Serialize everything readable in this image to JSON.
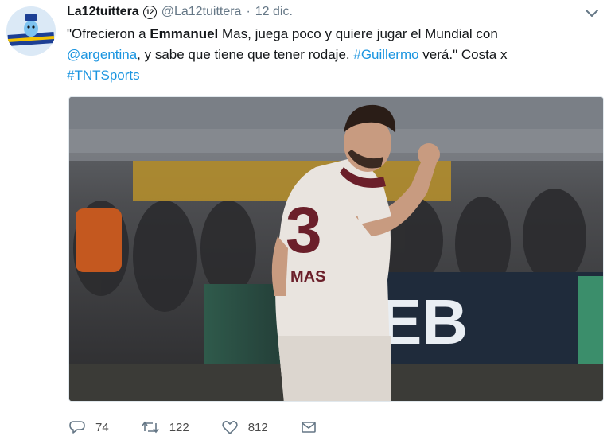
{
  "tweet": {
    "display_name": "La12tuittera",
    "badge_text": "12",
    "handle": "@La12tuittera",
    "separator": "·",
    "date": "12 dic.",
    "text": {
      "part1": "\"Ofrecieron a ",
      "bold1": "Emmanuel",
      "part2": " Mas, juega poco y quiere jugar el Mundial con",
      "mention": "@argentina",
      "part3": ", y sabe que tiene que tener rodaje. ",
      "hashtag1": "#Guillermo",
      "part4": " verá.\" Costa x",
      "hashtag2": "#TNTSports"
    },
    "media": {
      "jersey_number": "3",
      "jersey_name": "MAS",
      "board_text": "EB"
    },
    "actions": {
      "replies": "74",
      "retweets": "122",
      "likes": "812"
    },
    "colors": {
      "link": "#1b95e0",
      "muted": "#657786"
    }
  }
}
